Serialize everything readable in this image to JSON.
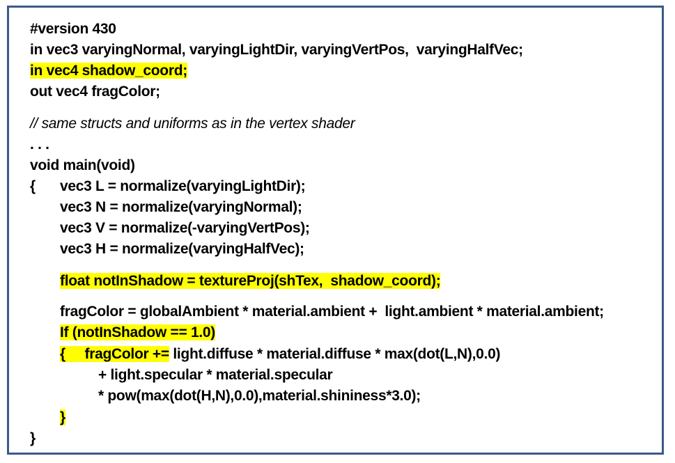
{
  "lines": [
    {
      "text": "#version 430",
      "highlight": false
    },
    {
      "text": "in vec3 varyingNormal, varyingLightDir, varyingVertPos,  varyingHalfVec;",
      "highlight": false
    },
    {
      "text": "in vec4 shadow_coord;",
      "highlight": true
    },
    {
      "text": "out vec4 fragColor;",
      "highlight": false
    },
    {
      "text": "// same structs and uniforms as in the vertex shader",
      "highlight": false
    },
    {
      "text": ". . .",
      "highlight": false
    },
    {
      "text": "void main(void)",
      "highlight": false
    },
    {
      "text": "{",
      "highlight": false
    },
    {
      "text": "vec3 L = normalize(varyingLightDir);",
      "highlight": false
    },
    {
      "text": "vec3 N = normalize(varyingNormal);",
      "highlight": false
    },
    {
      "text": "vec3 V = normalize(-varyingVertPos);",
      "highlight": false
    },
    {
      "text": "vec3 H = normalize(varyingHalfVec);",
      "highlight": false
    },
    {
      "text": "float notInShadow = textureProj(shTex,  shadow_coord);",
      "highlight": true
    },
    {
      "text": "fragColor = globalAmbient * material.ambient +  light.ambient * material.ambient;",
      "highlight": false
    },
    {
      "text": "If (notInShadow == 1.0)",
      "highlight": true
    },
    {
      "text": "{     fragColor +=",
      "highlight": true
    },
    {
      "text": " light.diffuse * material.diffuse * max(dot(L,N),0.0)",
      "highlight": false
    },
    {
      "text": "+ light.specular * material.specular",
      "highlight": false
    },
    {
      "text": "* pow(max(dot(H,N),0.0),material.shininess*3.0);",
      "highlight": false
    },
    {
      "text": "}",
      "highlight": true
    },
    {
      "text": "}",
      "highlight": false
    }
  ],
  "colors": {
    "border": "#3b5a89",
    "highlight": "#ffff00",
    "text": "#000000"
  }
}
